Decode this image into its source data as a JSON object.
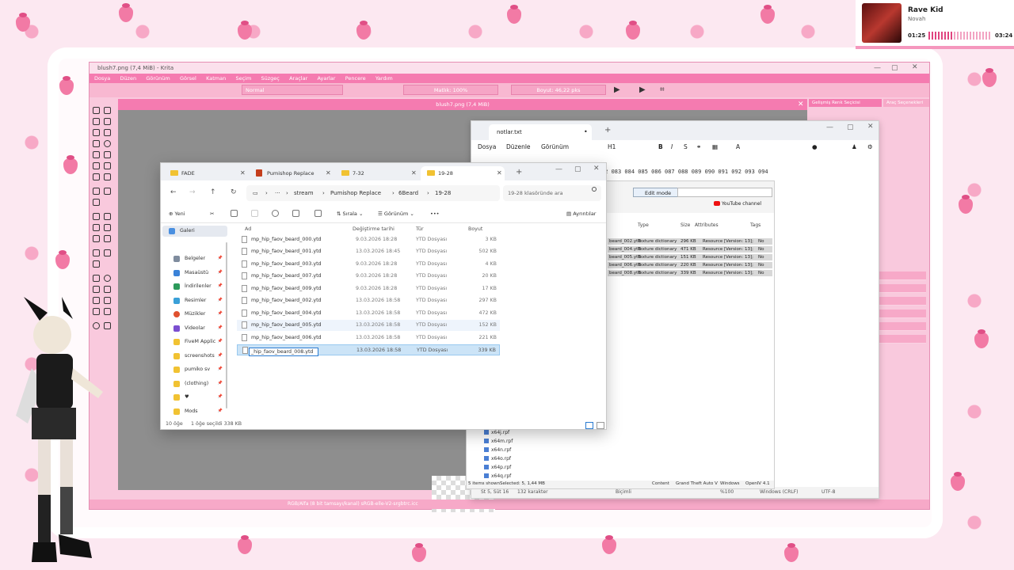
{
  "music": {
    "title": "Rave Kid",
    "artist": "Novah",
    "elapsed": "01:25",
    "duration": "03:24",
    "progress": 0.42
  },
  "krita": {
    "title": "blush7.png (7,4 MiB) - Krita",
    "canvas_tab": "blush7.png (7,4 MiB)",
    "blend_mode": "Normal",
    "opacity": "Matlık: 100%",
    "size": "Boyut: 46,22 pks",
    "menu": [
      "Dosya",
      "Düzen",
      "Görünüm",
      "Görsel",
      "Katman",
      "Seçim",
      "Süzgeç",
      "Araçlar",
      "Ayarlar",
      "Pencere",
      "Yardım"
    ],
    "dock_tab_1": "Gelişmiş Renk Seçicisi",
    "dock_tab_2": "Araç Seçenekleri",
    "status": "RGB/Alfa (8 bit tamsayı/kanal) sRGB-elle-V2-srgbtrc.icc"
  },
  "notepad": {
    "tab_title": "notlar.txt",
    "menu": [
      "Dosya",
      "Düzenle",
      "Görünüm"
    ],
    "heading": "H1",
    "text_line": "073 174 075 076 077 078 079 080 081 082 083 084 085 086 087 088 089 090 091 092 093 094",
    "status": {
      "position": "St 5, Süt 16",
      "chars": "132 karakter",
      "format": "Biçimli",
      "zoom": "%100",
      "eol": "Windows (CRLF)",
      "encoding": "UTF-8"
    }
  },
  "openiv": {
    "edit_mode": "Edit mode",
    "youtube": "YouTube channel",
    "columns": [
      "Type",
      "Size",
      "Attributes",
      "Tags"
    ],
    "rows": [
      {
        "name": "beard_002.ytd",
        "type": "Texture dictionary",
        "size": "296 KB",
        "attr": "Resource [Version: 13];",
        "tags": "No"
      },
      {
        "name": "beard_004.ytd",
        "type": "Texture dictionary",
        "size": "471 KB",
        "attr": "Resource [Version: 13];",
        "tags": "No"
      },
      {
        "name": "beard_005.ytd",
        "type": "Texture dictionary",
        "size": "151 KB",
        "attr": "Resource [Version: 13];",
        "tags": "No"
      },
      {
        "name": "beard_006.ytd",
        "type": "Texture dictionary",
        "size": "220 KB",
        "attr": "Resource [Version: 13];",
        "tags": "No"
      },
      {
        "name": "beard_008.ytd",
        "type": "Texture dictionary",
        "size": "339 KB",
        "attr": "Resource [Version: 13];",
        "tags": "No"
      }
    ],
    "tree_files": [
      "x64j.rpf",
      "x64m.rpf",
      "x64n.rpf",
      "x64o.rpf",
      "x64p.rpf",
      "x64q.rpf"
    ],
    "status": {
      "shown": "5 items shown",
      "selected": "Selected: 5, 1,44 MB",
      "content": "Content",
      "game": "Grand Theft Auto V",
      "os": "Windows",
      "app": "OpenIV 4.1"
    }
  },
  "explorer": {
    "tabs": [
      "FADE",
      "Pumishop Replace",
      "7-32",
      "19-28"
    ],
    "path": [
      "stream",
      "Pumishop Replace",
      "6Beard",
      "19-28"
    ],
    "search_placeholder": "19-28 klasöründe ara",
    "commands": {
      "new": "Yeni",
      "sort": "Sırala",
      "view": "Görünüm",
      "more": "•••",
      "details": "Ayrıntılar"
    },
    "sidebar": [
      "Galeri",
      "Belgeler",
      "Masaüstü",
      "İndirilenler",
      "Resimler",
      "Müzikler",
      "Videolar",
      "FiveM Applic",
      "screenshots",
      "pumiko sv",
      "(clothing)",
      "♥",
      "Mods"
    ],
    "columns": [
      "Ad",
      "Değiştirme tarihi",
      "Tür",
      "Boyut"
    ],
    "files": [
      {
        "name": "mp_hip_faov_beard_000.ytd",
        "date": "9.03.2026 18:28",
        "type": "YTD Dosyası",
        "size": "3 KB"
      },
      {
        "name": "mp_hip_faov_beard_001.ytd",
        "date": "13.03.2026 18:45",
        "type": "YTD Dosyası",
        "size": "502 KB"
      },
      {
        "name": "mp_hip_faov_beard_003.ytd",
        "date": "9.03.2026 18:28",
        "type": "YTD Dosyası",
        "size": "4 KB"
      },
      {
        "name": "mp_hip_faov_beard_007.ytd",
        "date": "9.03.2026 18:28",
        "type": "YTD Dosyası",
        "size": "20 KB"
      },
      {
        "name": "mp_hip_faov_beard_009.ytd",
        "date": "9.03.2026 18:28",
        "type": "YTD Dosyası",
        "size": "17 KB"
      },
      {
        "name": "mp_hip_faov_beard_002.ytd",
        "date": "13.03.2026 18:58",
        "type": "YTD Dosyası",
        "size": "297 KB"
      },
      {
        "name": "mp_hip_faov_beard_004.ytd",
        "date": "13.03.2026 18:58",
        "type": "YTD Dosyası",
        "size": "472 KB"
      },
      {
        "name": "mp_hip_faov_beard_005.ytd",
        "date": "13.03.2026 18:58",
        "type": "YTD Dosyası",
        "size": "152 KB"
      },
      {
        "name": "mp_hip_faov_beard_006.ytd",
        "date": "13.03.2026 18:58",
        "type": "YTD Dosyası",
        "size": "221 KB"
      },
      {
        "name": "_hip_faov_beard_008.ytd",
        "date": "13.03.2026 18:58",
        "type": "YTD Dosyası",
        "size": "339 KB"
      }
    ],
    "status": {
      "count": "10 öğe",
      "selected": "1 öğe seçildi  338 KB"
    }
  }
}
